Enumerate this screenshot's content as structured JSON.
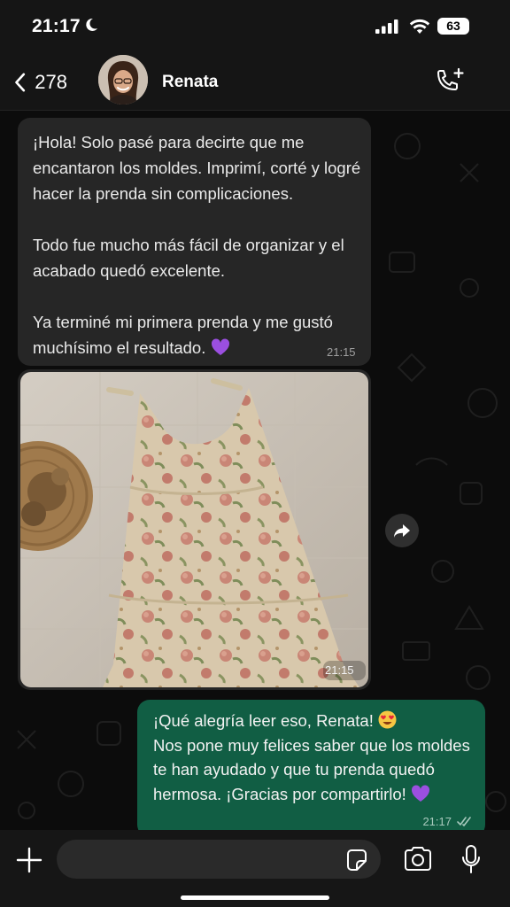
{
  "status": {
    "time": "21:17",
    "battery": "63"
  },
  "header": {
    "back_count": "278",
    "contact_name": "Renata"
  },
  "messages": {
    "incoming": {
      "p1": "¡Hola! Solo pasé para decirte que me encantaron los moldes. Imprimí, corté y logré hacer la prenda sin complicaciones.",
      "p2": "Todo fue mucho más fácil de organizar y el acabado quedó excelente.",
      "p3": "Ya terminé mi primera prenda y me gustó muchísimo el resultado.",
      "emoji": "purple-heart",
      "time": "21:15"
    },
    "photo": {
      "time": "21:15"
    },
    "outgoing": {
      "line1": "¡Qué alegría leer eso, Renata!",
      "line1_emoji": "heart-eyes-emoji",
      "body": "Nos pone muy felices saber que los moldes te han ayudado y que tu prenda quedó hermosa. ¡Gracias por compartirlo!",
      "emoji": "purple-heart",
      "time": "21:17",
      "status": "read"
    }
  },
  "input": {
    "placeholder": ""
  },
  "colors": {
    "incoming_bubble": "#262626",
    "outgoing_bubble": "#115e44",
    "background": "#0c0c0c"
  }
}
